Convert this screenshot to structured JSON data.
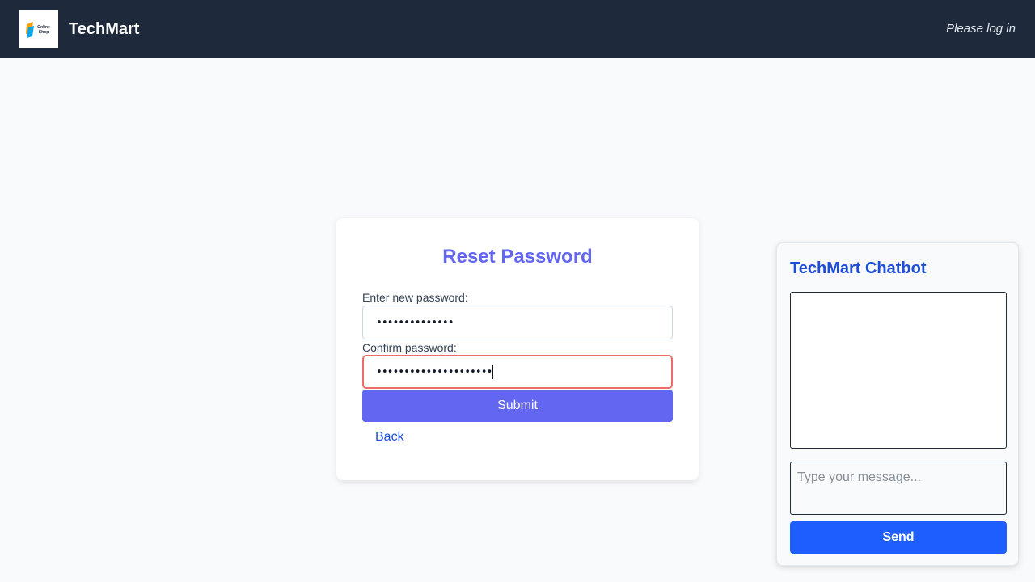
{
  "header": {
    "brand": "TechMart",
    "logo_text": "Online Shop",
    "login_status": "Please log in"
  },
  "reset_form": {
    "title": "Reset Password",
    "new_password_label": "Enter new password:",
    "new_password_value": "••••••••••••••",
    "confirm_password_label": "Confirm password:",
    "confirm_password_value": "•••••••••••••••••••••",
    "submit_label": "Submit",
    "back_label": "Back"
  },
  "chatbot": {
    "title": "TechMart Chatbot",
    "input_placeholder": "Type your message...",
    "send_label": "Send"
  },
  "colors": {
    "header_bg": "#1e293b",
    "accent": "#6366f1",
    "link": "#1d4ed8",
    "send_button": "#1e5eff",
    "focus_border": "#ef6b6b"
  }
}
